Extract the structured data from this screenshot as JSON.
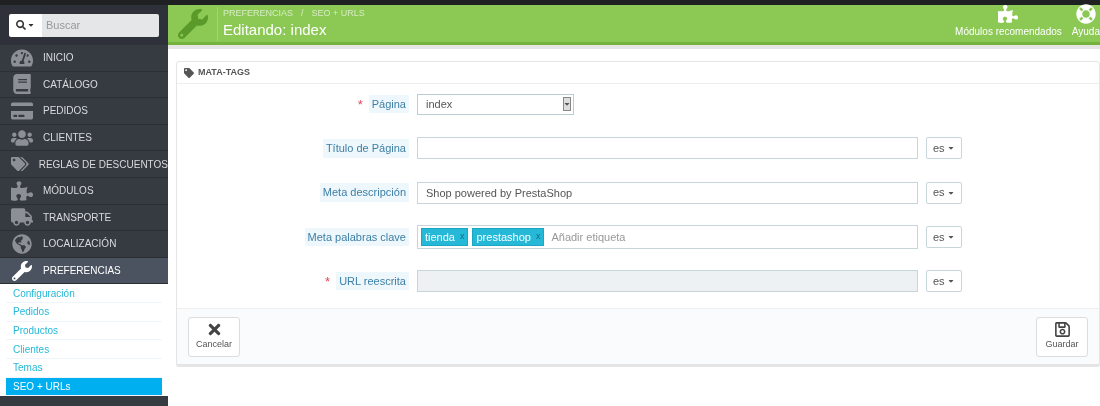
{
  "search": {
    "placeholder": "Buscar"
  },
  "sidebar": {
    "items": [
      {
        "label": "INICIO",
        "selected": false
      },
      {
        "label": "CATÁLOGO",
        "selected": false
      },
      {
        "label": "PEDIDOS",
        "selected": false
      },
      {
        "label": "CLIENTES",
        "selected": false
      },
      {
        "label": "REGLAS DE DESCUENTOS",
        "selected": false
      },
      {
        "label": "MÓDULOS",
        "selected": false
      },
      {
        "label": "TRANSPORTE",
        "selected": false
      },
      {
        "label": "LOCALIZACIÓN",
        "selected": false
      },
      {
        "label": "PREFERENCIAS",
        "selected": true,
        "children": [
          {
            "label": "Configuración",
            "selected": false
          },
          {
            "label": "Pedidos",
            "selected": false
          },
          {
            "label": "Productos",
            "selected": false
          },
          {
            "label": "Clientes",
            "selected": false
          },
          {
            "label": "Temas",
            "selected": false
          },
          {
            "label": "SEO + URLs",
            "selected": true
          }
        ]
      }
    ]
  },
  "header": {
    "breadcrumb": [
      "PREFERENCIAS",
      "SEO + URLS"
    ],
    "breadcrumb_separator": "/",
    "title": "Editando: index",
    "toolbar": [
      "Módulos recomendados",
      "Ayuda"
    ]
  },
  "panel": {
    "title": "MATA-TAGS",
    "fields": [
      {
        "kind": "select",
        "label": "Página",
        "required_mark": "*",
        "value": "index"
      },
      {
        "kind": "text",
        "label": "Título de Página",
        "lang": "es"
      },
      {
        "kind": "text",
        "label": "Meta descripción",
        "value": "Shop powered by PrestaShop",
        "lang": "es"
      },
      {
        "kind": "tags",
        "label": "Meta palabras clave",
        "tags": [
          {
            "label": "tienda",
            "remove": "x"
          },
          {
            "label": "prestashop",
            "remove": "x"
          }
        ],
        "placeholder": "Añadir etiqueta",
        "lang": "es"
      },
      {
        "kind": "text",
        "label": "URL reescrita",
        "required_mark": "*",
        "disabled": true,
        "lang": "es"
      }
    ],
    "buttons": [
      "Cancelar",
      "Guardar"
    ]
  }
}
